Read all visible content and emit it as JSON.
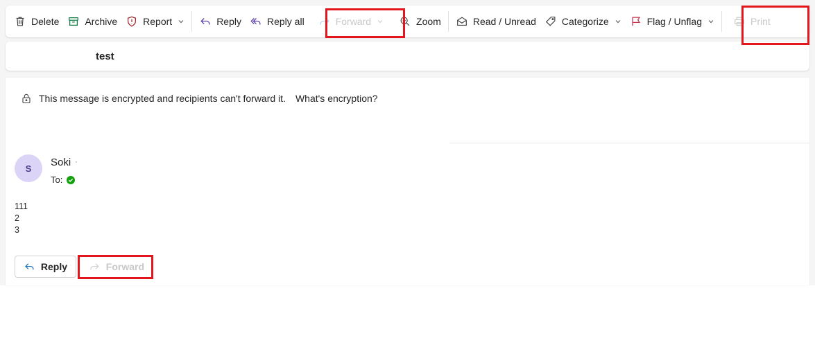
{
  "toolbar": {
    "delete": "Delete",
    "archive": "Archive",
    "report": "Report",
    "reply": "Reply",
    "reply_all": "Reply all",
    "forward": "Forward",
    "zoom": "Zoom",
    "read_unread": "Read / Unread",
    "categorize": "Categorize",
    "flag_unflag": "Flag / Unflag",
    "print": "Print"
  },
  "message": {
    "subject": "test",
    "encryption_notice": "This message is encrypted and recipients can't forward it.",
    "encryption_link": "What's encryption?",
    "sender_initial": "S",
    "sender_name": "Soki",
    "sender_separator": "·",
    "to_label": "To:",
    "body_lines": [
      "111",
      "2",
      "3"
    ]
  },
  "actions": {
    "reply": "Reply",
    "forward": "Forward"
  },
  "colors": {
    "highlight": "#e3161e",
    "avatar_bg": "#dcd4f7",
    "disabled_text": "#c8c8c8",
    "verified_green": "#13a10e",
    "flag_red": "#c4314b",
    "archive_green": "#107c41",
    "reply_all_purple": "#5b3fa8"
  },
  "icons": [
    "trash-icon",
    "archive-icon",
    "shield-icon",
    "reply-icon",
    "reply-all-icon",
    "forward-icon",
    "zoom-icon",
    "envelope-open-icon",
    "tag-icon",
    "flag-icon",
    "printer-icon",
    "lock-icon",
    "check-circle-icon",
    "chevron-down-icon"
  ]
}
